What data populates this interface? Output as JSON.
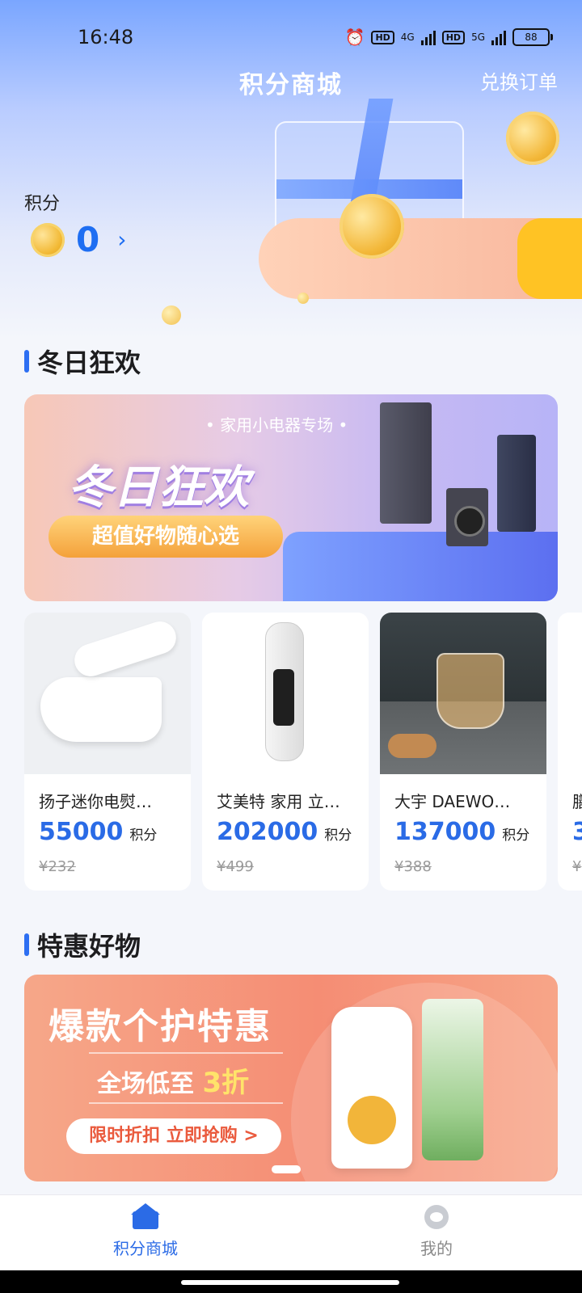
{
  "status_bar": {
    "time": "16:48",
    "badge_hd": "HD",
    "net_4g": "4G",
    "net_5g": "5G",
    "battery": "88",
    "icons": [
      "alarm-icon",
      "signal-icon",
      "battery-icon"
    ]
  },
  "header": {
    "title": "积分商城",
    "orders_link": "兑换订单"
  },
  "points": {
    "label": "积分",
    "value": "0",
    "chevron": "›"
  },
  "section_winter": {
    "title": "冬日狂欢",
    "banner": {
      "subtitle": "• 家用小电器专场 •",
      "headline": "冬日狂欢",
      "button": "超值好物随心选"
    },
    "products": [
      {
        "name": "扬子迷你电熨…",
        "points": "55000",
        "unit": "积分",
        "price": "¥232"
      },
      {
        "name": "艾美特 家用 立…",
        "points": "202000",
        "unit": "积分",
        "price": "¥499"
      },
      {
        "name": "大宇 DAEWO…",
        "points": "137000",
        "unit": "积分",
        "price": "¥388"
      },
      {
        "name": "膳",
        "points": "3",
        "unit": "",
        "price": "¥"
      }
    ]
  },
  "section_deals": {
    "title": "特惠好物",
    "banner": {
      "headline": "爆款个护特惠",
      "sub_prefix": "全场低至",
      "sub_highlight": "3折",
      "button": "限时折扣 立即抢购 >"
    }
  },
  "tabbar": {
    "items": [
      {
        "label": "积分商城",
        "icon": "home-icon",
        "active": true
      },
      {
        "label": "我的",
        "icon": "profile-icon",
        "active": false
      }
    ]
  },
  "colors": {
    "accent": "#2b6be6",
    "price_blue": "#2a6be6",
    "deal_banner": "#f58d74"
  }
}
